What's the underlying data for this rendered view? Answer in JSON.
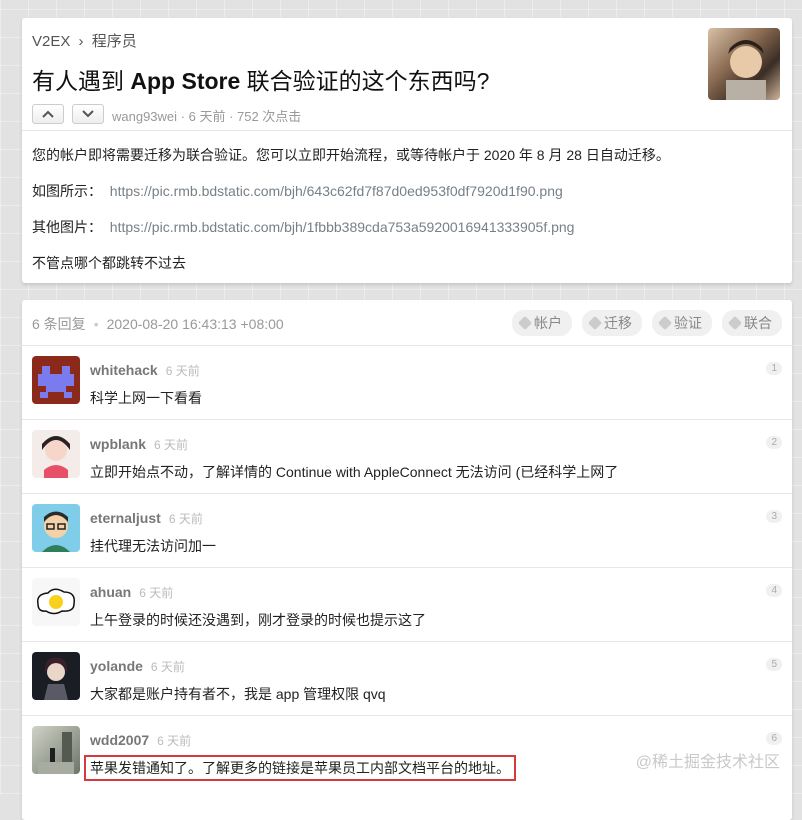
{
  "breadcrumb": {
    "site": "V2EX",
    "sep": "›",
    "node": "程序员"
  },
  "topic": {
    "title_pre": "有人遇到 ",
    "title_bold": "App Store",
    "title_post": " 联合验证的这个东西吗?",
    "meta": "wang93wei · 6 天前 · 752 次点击",
    "content": {
      "line1": "您的帐户即将需要迁移为联合验证。您可以立即开始流程，或等待帐户于 2020 年 8 月 28 日自动迁移。",
      "line2_label": "如图所示：",
      "line2_link": "https://pic.rmb.bdstatic.com/bjh/643c62fd7f87d0ed953f0df7920d1f90.png",
      "line3_label": "其他图片：",
      "line3_link": "https://pic.rmb.bdstatic.com/bjh/1fbbb389cda753a5920016941333905f.png",
      "line4": "不管点哪个都跳转不过去"
    }
  },
  "replies_header": {
    "count": "6 条回复",
    "dot": "•",
    "date": "2020-08-20 16:43:13 +08:00",
    "tags": [
      "帐户",
      "迁移",
      "验证",
      "联合"
    ]
  },
  "replies": [
    {
      "user": "whitehack",
      "time": "6 天前",
      "text": "科学上网一下看看",
      "no": "1"
    },
    {
      "user": "wpblank",
      "time": "6 天前",
      "text": "立即开始点不动，了解详情的 Continue with AppleConnect 无法访问 (已经科学上网了",
      "no": "2"
    },
    {
      "user": "eternaljust",
      "time": "6 天前",
      "text": "挂代理无法访问加一",
      "no": "3"
    },
    {
      "user": "ahuan",
      "time": "6 天前",
      "text": "上午登录的时候还没遇到，刚才登录的时候也提示这了",
      "no": "4"
    },
    {
      "user": "yolande",
      "time": "6 天前",
      "text": "大家都是账户持有者不，我是 app 管理权限 qvq",
      "no": "5"
    },
    {
      "user": "wdd2007",
      "time": "6 天前",
      "text": "苹果发错通知了。了解更多的链接是苹果员工内部文档平台的地址。",
      "no": "6"
    }
  ],
  "watermark": "@稀土掘金技术社区",
  "colors": {
    "highlight_border": "#d63a3a",
    "link": "#778087"
  }
}
